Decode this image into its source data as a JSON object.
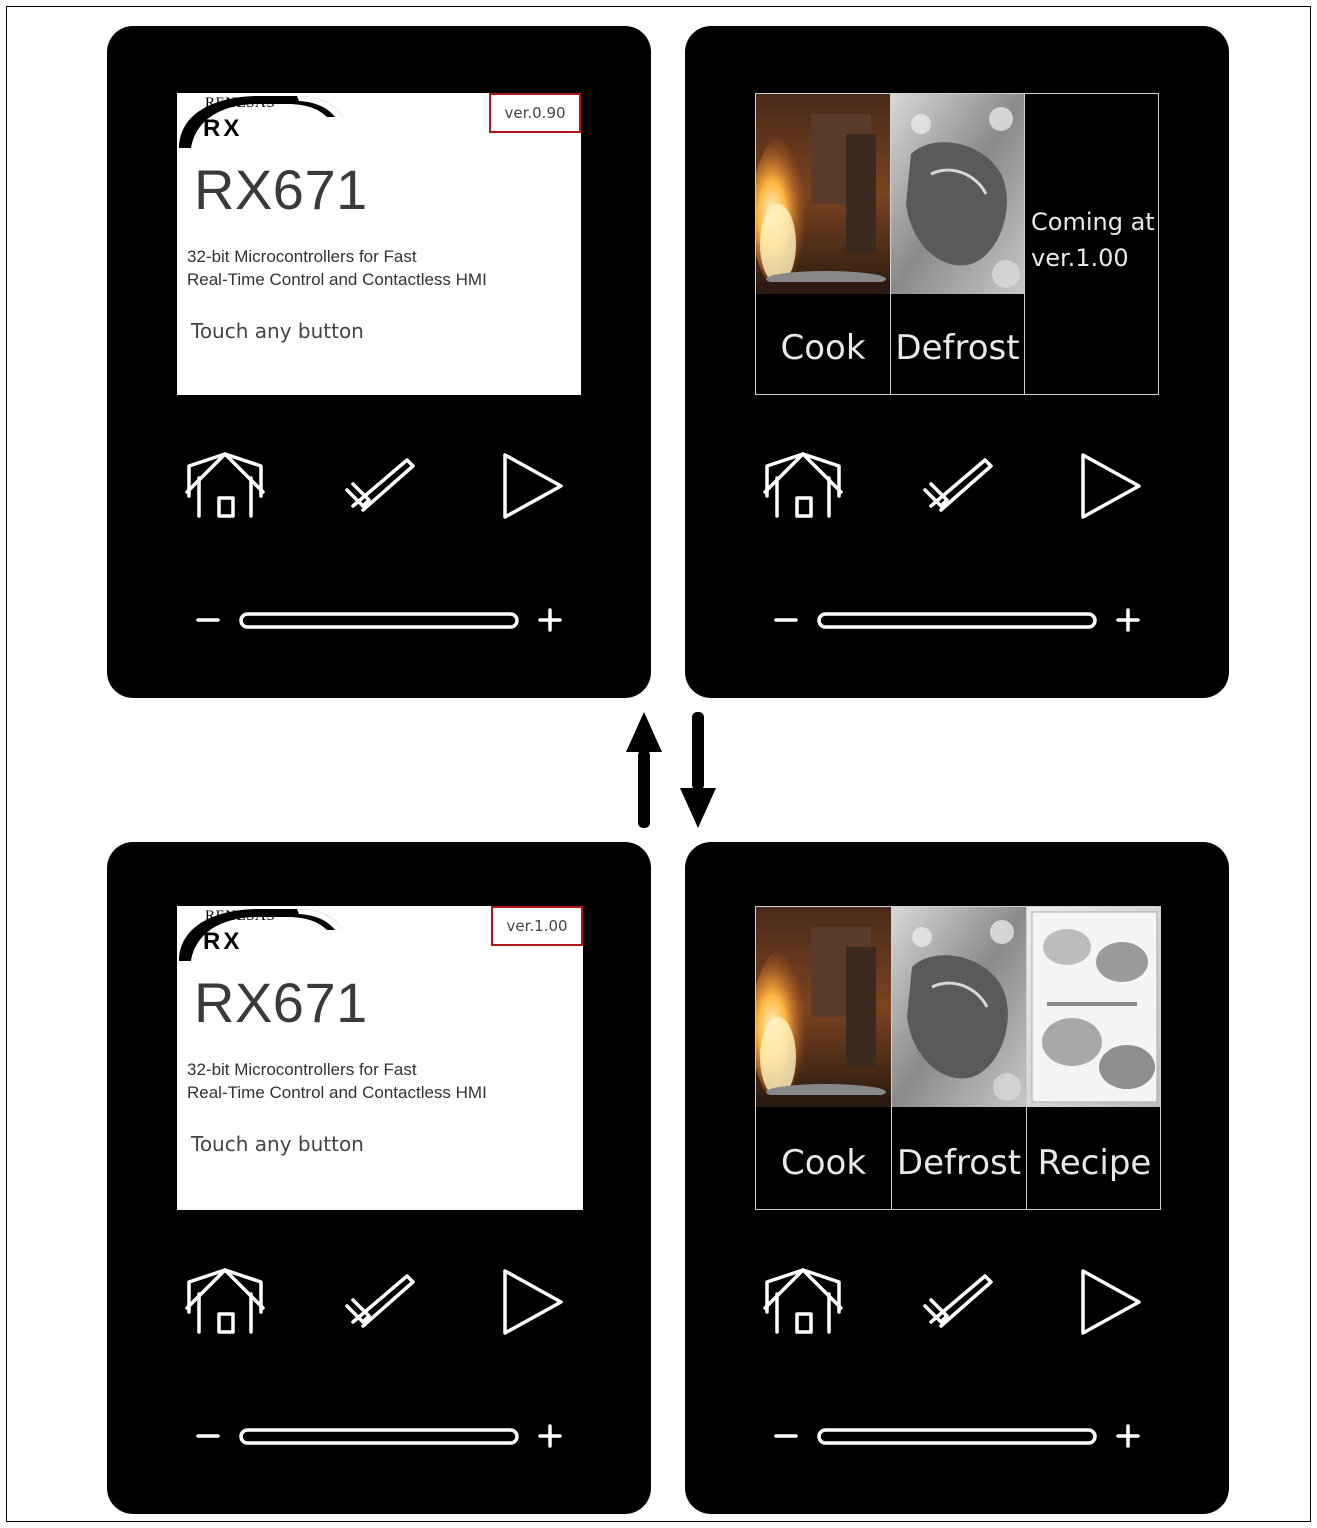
{
  "panels": [
    {
      "screen": "splash",
      "logo": {
        "brand": "RENESAS",
        "family": "RX"
      },
      "version": "ver.0.90",
      "model": "RX671",
      "description_line1": "32-bit Microcontrollers for Fast",
      "description_line2": "Real-Time Control and Contactless HMI",
      "prompt": "Touch any button"
    },
    {
      "screen": "menu",
      "tiles": [
        {
          "label": "Cook",
          "image": "flame-cooking-photo"
        },
        {
          "label": "Defrost",
          "image": "frozen-steak-photo"
        }
      ],
      "coming_line1": "Coming at",
      "coming_line2": "ver.1.00"
    },
    {
      "screen": "splash",
      "logo": {
        "brand": "RENESAS",
        "family": "RX"
      },
      "version": "ver.1.00",
      "model": "RX671",
      "description_line1": "32-bit Microcontrollers for Fast",
      "description_line2": "Real-Time Control and Contactless HMI",
      "prompt": "Touch any button"
    },
    {
      "screen": "menu",
      "tiles": [
        {
          "label": "Cook",
          "image": "flame-cooking-photo"
        },
        {
          "label": "Defrost",
          "image": "frozen-steak-photo"
        },
        {
          "label": "Recipe",
          "image": "recipe-book-photo"
        }
      ]
    }
  ],
  "controls": {
    "icons": [
      "home-icon",
      "check-icon",
      "play-icon",
      "minus-icon",
      "slider-track",
      "plus-icon"
    ],
    "minus": "−",
    "plus": "+"
  },
  "colors": {
    "device": "#000000",
    "version_box_border": "#b01818",
    "screen_bg": "#ffffff",
    "tile_border": "#d0d0d0"
  },
  "transition_arrows": [
    "up-arrow-icon",
    "down-arrow-icon"
  ]
}
